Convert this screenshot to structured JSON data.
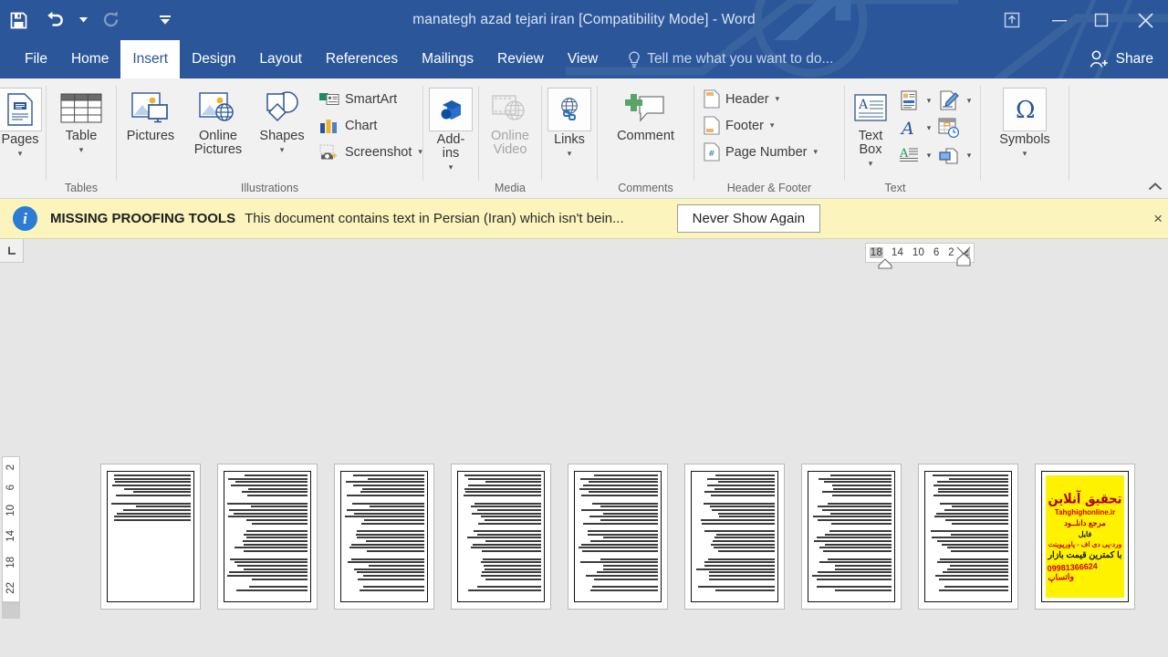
{
  "window": {
    "title": "manategh azad tejari iran [Compatibility Mode] - Word",
    "quick_access": [
      {
        "name": "save",
        "label": "Save",
        "icon": "save-icon",
        "disabled": false
      },
      {
        "name": "undo",
        "label": "Undo",
        "icon": "undo-icon",
        "disabled": false
      },
      {
        "name": "undo-dropdown",
        "label": "",
        "icon": "chevron-down-icon",
        "disabled": false
      },
      {
        "name": "redo",
        "label": "Repeat",
        "icon": "redo-icon",
        "disabled": true
      },
      {
        "name": "customize-qat",
        "label": "Customize Quick Access Toolbar",
        "icon": "chevron-down-bar-icon",
        "disabled": false
      }
    ],
    "controls": [
      {
        "name": "ribbon-display-options",
        "label": "Ribbon Display Options",
        "icon": "ribbon-display-icon"
      },
      {
        "name": "minimize",
        "label": "Minimize",
        "icon": "minimize-icon"
      },
      {
        "name": "restore",
        "label": "Restore Down",
        "icon": "restore-icon"
      },
      {
        "name": "close",
        "label": "Close",
        "icon": "close-icon"
      }
    ]
  },
  "tabs": {
    "items": [
      {
        "label": "File",
        "active": false
      },
      {
        "label": "Home",
        "active": false
      },
      {
        "label": "Insert",
        "active": true
      },
      {
        "label": "Design",
        "active": false
      },
      {
        "label": "Layout",
        "active": false
      },
      {
        "label": "References",
        "active": false
      },
      {
        "label": "Mailings",
        "active": false
      },
      {
        "label": "Review",
        "active": false
      },
      {
        "label": "View",
        "active": false
      }
    ],
    "tell_me": "Tell me what you want to do...",
    "share": "Share"
  },
  "ribbon": {
    "collapse_label": "Collapse the Ribbon",
    "groups": [
      {
        "name": "pages",
        "label": "",
        "big_buttons": [
          {
            "label": "Pages",
            "icon": "cover-page-icon",
            "has_caret": true,
            "disabled": false,
            "boxed": true
          }
        ],
        "small_buttons": []
      },
      {
        "name": "tables",
        "label": "Tables",
        "big_buttons": [
          {
            "label": "Table",
            "icon": "table-icon",
            "has_caret": true,
            "disabled": false,
            "boxed": false
          }
        ],
        "small_buttons": []
      },
      {
        "name": "illustrations",
        "label": "Illustrations",
        "big_buttons": [
          {
            "label": "Pictures",
            "icon": "pictures-icon",
            "has_caret": false,
            "disabled": false,
            "boxed": false
          },
          {
            "label": "Online\nPictures",
            "icon": "online-pictures-icon",
            "has_caret": false,
            "disabled": false,
            "boxed": false
          },
          {
            "label": "Shapes",
            "icon": "shapes-icon",
            "has_caret": true,
            "disabled": false,
            "boxed": false
          }
        ],
        "small_buttons": [
          {
            "label": "SmartArt",
            "icon": "smartart-icon",
            "has_caret": false
          },
          {
            "label": "Chart",
            "icon": "chart-icon",
            "has_caret": false
          },
          {
            "label": "Screenshot",
            "icon": "screenshot-icon",
            "has_caret": true
          }
        ]
      },
      {
        "name": "add-ins",
        "label": "",
        "big_buttons": [
          {
            "label": "Add-\nins",
            "icon": "addins-icon",
            "has_caret": true,
            "disabled": false,
            "boxed": true
          }
        ],
        "small_buttons": []
      },
      {
        "name": "media",
        "label": "Media",
        "big_buttons": [
          {
            "label": "Online\nVideo",
            "icon": "online-video-icon",
            "has_caret": false,
            "disabled": true,
            "boxed": false
          }
        ],
        "small_buttons": []
      },
      {
        "name": "links",
        "label": "",
        "big_buttons": [
          {
            "label": "Links",
            "icon": "links-icon",
            "has_caret": true,
            "disabled": false,
            "boxed": true
          }
        ],
        "small_buttons": []
      },
      {
        "name": "comments",
        "label": "Comments",
        "big_buttons": [
          {
            "label": "Comment",
            "icon": "new-comment-icon",
            "has_caret": false,
            "disabled": false,
            "boxed": false
          }
        ],
        "small_buttons": []
      },
      {
        "name": "header-footer",
        "label": "Header & Footer",
        "big_buttons": [],
        "small_buttons": [
          {
            "label": "Header",
            "icon": "header-icon",
            "has_caret": true
          },
          {
            "label": "Footer",
            "icon": "footer-icon",
            "has_caret": true
          },
          {
            "label": "Page Number",
            "icon": "page-number-icon",
            "has_caret": true
          }
        ]
      },
      {
        "name": "text",
        "label": "Text",
        "big_buttons": [
          {
            "label": "Text\nBox",
            "icon": "text-box-icon",
            "has_caret": true,
            "disabled": false,
            "boxed": false
          }
        ],
        "icon_grid": [
          {
            "icon": "quick-parts-icon",
            "caret": true
          },
          {
            "icon": "signature-line-icon",
            "caret": true
          },
          {
            "icon": "wordart-icon",
            "caret": true
          },
          {
            "icon": "date-time-icon",
            "caret": false
          },
          {
            "icon": "drop-cap-icon",
            "caret": true
          },
          {
            "icon": "object-icon",
            "caret": true
          }
        ]
      },
      {
        "name": "symbols",
        "label": "",
        "big_buttons": [
          {
            "label": "Symbols",
            "icon": "omega-icon",
            "has_caret": true,
            "disabled": false,
            "boxed": true
          }
        ],
        "small_buttons": []
      }
    ]
  },
  "message_bar": {
    "icon": "info-icon",
    "title": "MISSING PROOFING TOOLS",
    "text": "This document contains text in Persian (Iran) which isn't bein...",
    "button": "Never Show Again",
    "close": "×",
    "background_color": "#fbf4bd"
  },
  "rulers": {
    "corner_icon": "tab-stop-left-icon",
    "horizontal_ticks": [
      "18",
      "14",
      "10",
      "6",
      "2",
      "2"
    ],
    "vertical_ticks": [
      "2",
      "2",
      "6",
      "10",
      "14",
      "18",
      "22"
    ]
  },
  "document": {
    "pages": [
      {
        "index": 1,
        "type": "text",
        "lines": 13,
        "fill_ratio": 0.42
      },
      {
        "index": 2,
        "type": "text",
        "lines": 30,
        "fill_ratio": 0.96
      },
      {
        "index": 3,
        "type": "text",
        "lines": 30,
        "fill_ratio": 0.96
      },
      {
        "index": 4,
        "type": "text",
        "lines": 30,
        "fill_ratio": 0.96
      },
      {
        "index": 5,
        "type": "text",
        "lines": 30,
        "fill_ratio": 0.96
      },
      {
        "index": 6,
        "type": "text",
        "lines": 30,
        "fill_ratio": 0.96
      },
      {
        "index": 7,
        "type": "text",
        "lines": 30,
        "fill_ratio": 0.96
      },
      {
        "index": 8,
        "type": "text",
        "lines": 30,
        "fill_ratio": 0.96
      },
      {
        "index": 9,
        "type": "advertisement",
        "background_color": "#fff200",
        "lines": [
          "تحقیق آنلاین",
          "Tahghighonline.ir",
          "مرجع دانلــود",
          "فایل",
          "ورد-پی دی اف - پاورپوینت",
          "با کمترین قیمت بازار",
          "09981366624 واتساپ"
        ]
      }
    ]
  },
  "colors": {
    "titlebar": "#2b579a",
    "ribbon": "#f1f1f1",
    "workspace": "#e6e6e6",
    "message_bar": "#fbf4bd",
    "accent": "#2b579a"
  }
}
